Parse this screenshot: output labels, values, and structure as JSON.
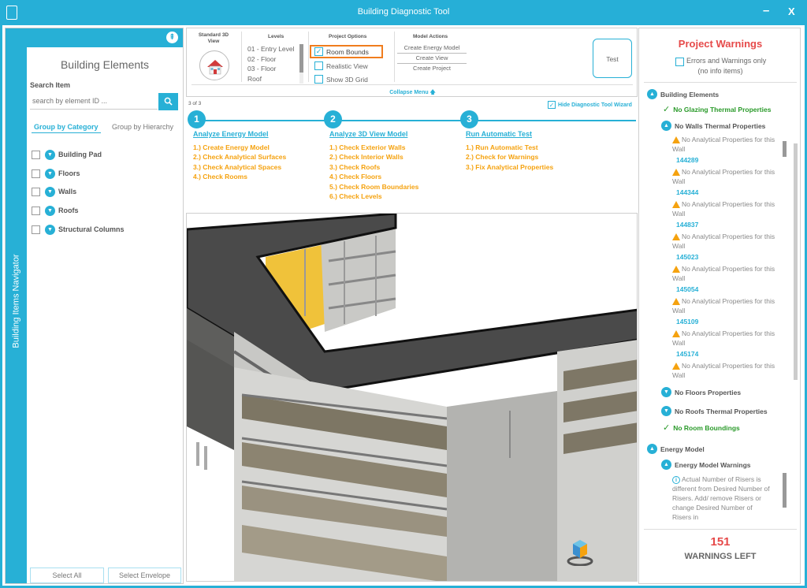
{
  "window": {
    "title": "Building Diagnostic Tool",
    "minimize": "–",
    "close": "X"
  },
  "left": {
    "nav_label": "Building Items Navigator",
    "title": "Building Elements",
    "search_label": "Search Item",
    "search_placeholder": "search by element ID ...",
    "tabs": [
      "Group by Category",
      "Group by Hierarchy"
    ],
    "items": [
      "Building Pad",
      "Floors",
      "Walls",
      "Roofs",
      "Structural Columns"
    ],
    "select_all": "Select All",
    "select_envelope": "Select Envelope"
  },
  "toolbar": {
    "standard_view_title": "Standard 3D View",
    "levels_title": "Levels",
    "levels": [
      "01 - Entry Level",
      "02 - Floor",
      "03 - Floor",
      "Roof"
    ],
    "options_title": "Project Options",
    "options": [
      {
        "label": "Room Bounds",
        "checked": true
      },
      {
        "label": "Realistic View",
        "checked": false
      },
      {
        "label": "Show 3D Grid",
        "checked": false
      }
    ],
    "actions_title": "Model Actions",
    "actions": [
      "Create Energy Model",
      "Create View",
      "Create Project"
    ],
    "test_label": "Test",
    "collapse_label": "Collapse Menu 🡅"
  },
  "wizard": {
    "page": "3 of 3",
    "hide_label": "Hide Diagnostic Tool Wizard",
    "steps": [
      {
        "number": "1",
        "title": "Analyze Energy Model",
        "items": [
          "1.) Create Energy Model",
          "2.) Check Analytical Surfaces",
          "3.) Check Analytical Spaces",
          "4.) Check Rooms"
        ]
      },
      {
        "number": "2",
        "title": "Analyze 3D View Model",
        "items": [
          "1.) Check Exterior Walls",
          "2.) Check Interior Walls",
          "3.) Check Roofs",
          "4.) Check Floors",
          "5.) Check Room Boundaries",
          "6.) Check Levels"
        ]
      },
      {
        "number": "3",
        "title": "Run Automatic Test",
        "items": [
          "1.) Run Automatic Test",
          "2.) Check for Warnings",
          "3.) Fix Analytical Properties"
        ]
      }
    ]
  },
  "warnings": {
    "title": "Project Warnings",
    "filter_label": "Errors and Warnings only",
    "filter_sub": "(no info items)",
    "building_elements": "Building Elements",
    "no_glazing": "No Glazing Thermal Properties",
    "no_walls": "No Walls Thermal Properties",
    "wall_msg": "No Analytical Properties for this Wall",
    "wall_ids": [
      "144289",
      "144344",
      "144837",
      "145023",
      "145054",
      "145109",
      "145174"
    ],
    "no_floors": "No Floors Properties",
    "no_roofs": "No Roofs Thermal Properties",
    "no_room": "No Room Boundings",
    "energy_model": "Energy Model",
    "energy_warnings": "Energy Model Warnings",
    "riser_msg": "Actual Number of Risers is different from Desired Number of Risers. Add/ remove Risers or change Desired Number of Risers in",
    "count": "151",
    "count_label": "WARNINGS LEFT"
  }
}
